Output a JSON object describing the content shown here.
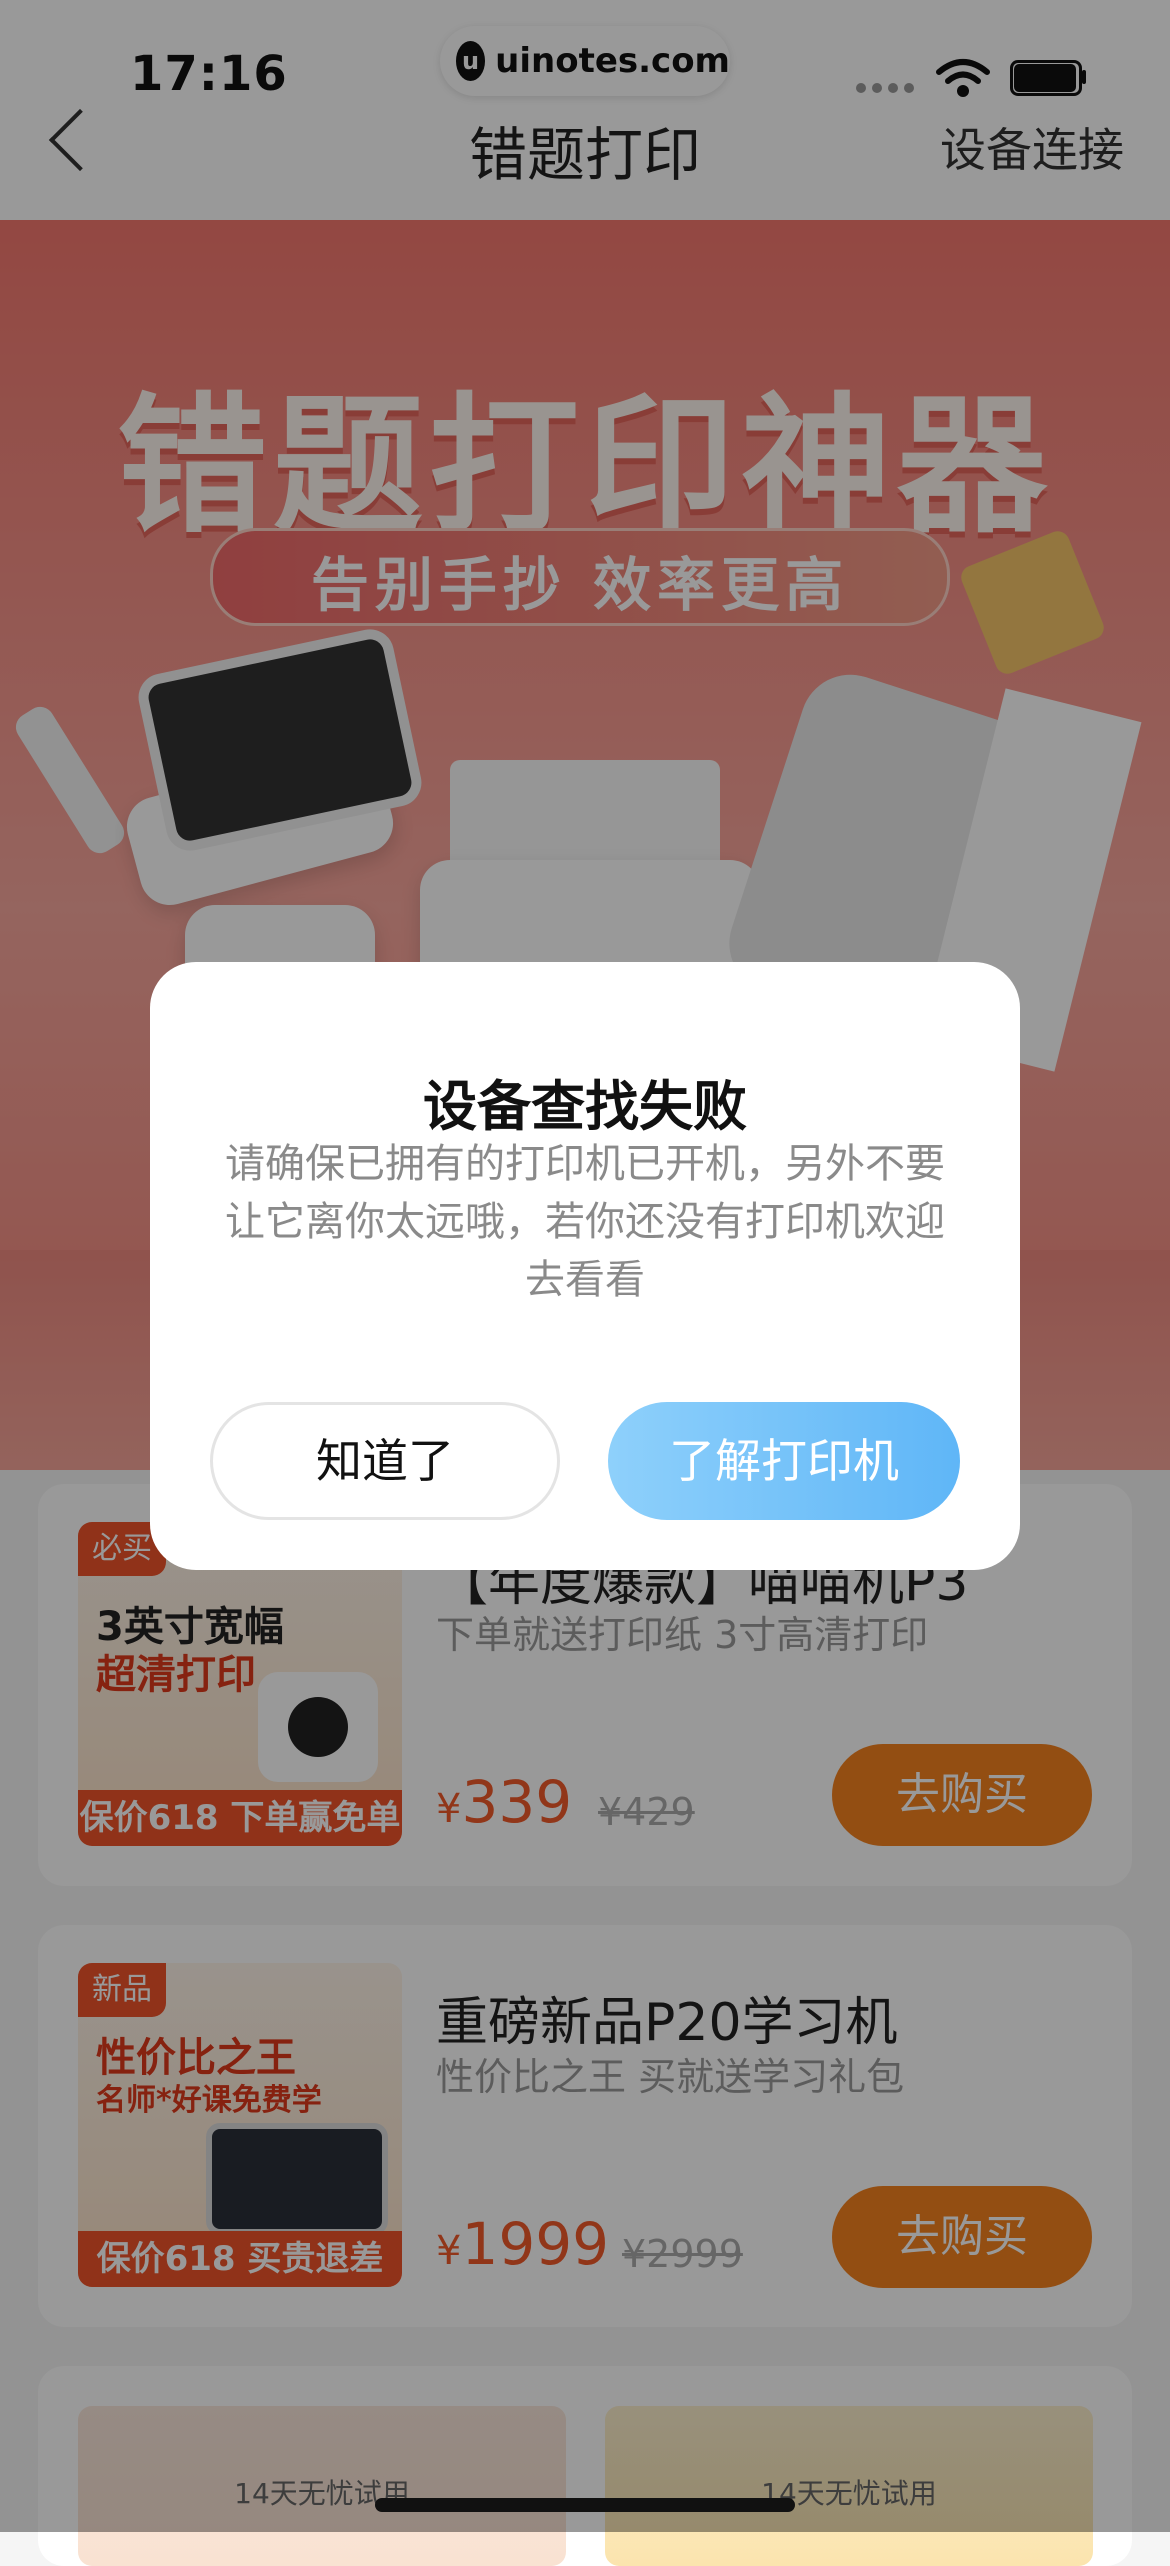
{
  "status_bar": {
    "time": "17:16",
    "url": "uinotes.com"
  },
  "nav": {
    "title": "错题打印",
    "right_link": "设备连接"
  },
  "banner": {
    "title": "错题打印神器",
    "subtitle": "告别手抄 效率更高"
  },
  "dialog": {
    "title": "设备查找失败",
    "message": "请确保已拥有的打印机已开机，另外不要让它离你太远哦，若你还没有打印机欢迎去看看",
    "cancel_label": "知道了",
    "confirm_label": "了解打印机"
  },
  "products": [
    {
      "tag": "必买",
      "thumb_line1": "3英寸宽幅",
      "thumb_line2": "超清打印",
      "thumb_band": "保价618 下单赢免单",
      "title": "【年度爆款】喵喵机P3",
      "subtitle": "下单就送打印纸 3寸高清打印",
      "price": "339",
      "original_price": "¥429",
      "buy_label": "去购买"
    },
    {
      "tag": "新品",
      "thumb_line1": "性价比之王",
      "thumb_line2": "名师*好课免费学",
      "thumb_band": "保价618 买贵退差",
      "title": "重磅新品P20学习机",
      "subtitle": "性价比之王 买就送学习礼包",
      "price": "1999",
      "original_price": "¥2999",
      "buy_label": "去购买"
    }
  ],
  "mini_cards": [
    {
      "caption": "14天无忧试用"
    },
    {
      "caption": "14天无忧试用"
    }
  ],
  "currency_symbol": "¥",
  "colors": {
    "accent_orange": "#f5821f",
    "price_red": "#f25a2a",
    "dialog_blue": "#5fb6f7"
  }
}
